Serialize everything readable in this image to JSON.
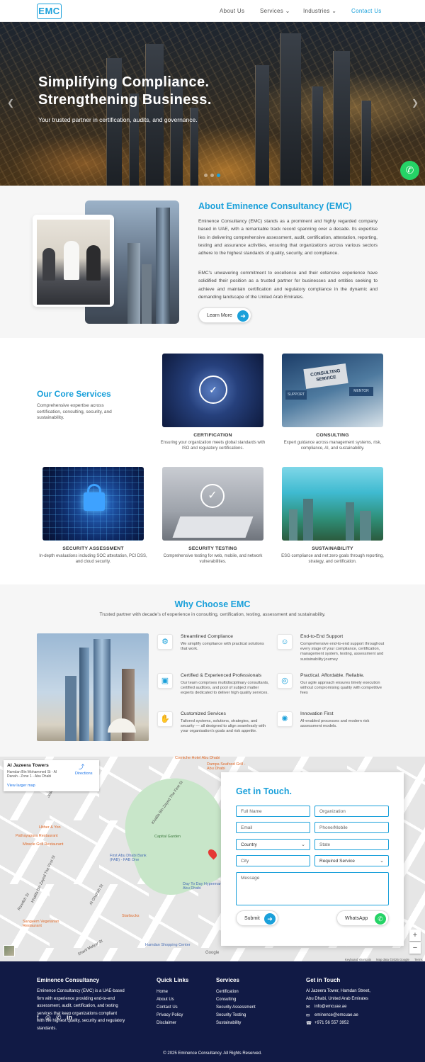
{
  "header": {
    "logo": "EMC",
    "nav": [
      {
        "label": "About Us"
      },
      {
        "label": "Services ⌄"
      },
      {
        "label": "Industries ⌄"
      },
      {
        "label": "Contact Us"
      }
    ]
  },
  "hero": {
    "title_line1": "Simplifying Compliance.",
    "title_line2": "Strengthening Business.",
    "subtitle": "Your trusted partner in certification, audits, and governance.",
    "prev_icon": "chevron-left-icon",
    "next_icon": "chevron-right-icon",
    "whatsapp_icon": "whatsapp-icon"
  },
  "about": {
    "title": "About Eminence Consultancy (EMC)",
    "para1": "Eminence Consultancy (EMC) stands as a prominent and highly regarded company based in UAE, with a remarkable track record spanning over a decade. Its expertise lies in delivering comprehensive assessment, audit, certification, attestation, reporting, testing and assurance activities, ensuring that organizations across various sectors adhere to the highest standards of quality, security, and compliance.",
    "para2": "EMC's unwavering commitment to excellence and their extensive experience have solidified their position as a trusted partner for businesses and entities seeking to achieve and maintain certification and regulatory compliance in the dynamic and demanding landscape of the United Arab Emirates.",
    "button": "Learn More"
  },
  "services": {
    "title": "Our Core Services",
    "subtitle": "Comprehensive expertise across certification, consulting, security, and sustainability.",
    "items": [
      {
        "title": "CERTIFICATION",
        "desc": "Ensuring your organization meets global standards with ISO and regulatory certifications."
      },
      {
        "title": "CONSULTING",
        "desc": "Expert guidance across management systems, risk, compliance, AI, and sustainability."
      },
      {
        "title": "SECURITY ASSESSMENT",
        "desc": "In-depth evaluations including SOC attestation, PCI DSS, and cloud security."
      },
      {
        "title": "SECURITY TESTING",
        "desc": "Comprehensive testing for web, mobile, and network vulnerabilities."
      },
      {
        "title": "SUSTAINABILITY",
        "desc": "ESG compliance and net zero goals through reporting, strategy, and certification."
      }
    ],
    "card_text": {
      "consulting_sign": "CONSULTING SERVICE",
      "support": "SUPPORT",
      "mentor": "MENTOR"
    }
  },
  "why": {
    "title": "Why Choose EMC",
    "subtitle": "Trusted partner with decade's of experience in consulting, certification, testing, assessment and sustainability.",
    "items": [
      {
        "title": "Streamlined Compliance",
        "desc": "We simplify compliance with practical solutions that work."
      },
      {
        "title": "End-to-End Support",
        "desc": "Comprehensive end-to-end support throughout every stage of your compliance, certification, management system, testing, assessment and sustainability journey"
      },
      {
        "title": "Certified & Experienced Professionals",
        "desc": "Our team comprises multidisciplinary consultants, certified auditors, and pool of subject matter experts dedicated to deliver high quality services."
      },
      {
        "title": "Practical. Affordable. Reliable.",
        "desc": "Our agile approach ensures timely execution without compromising quality with competitive fees"
      },
      {
        "title": "Customized Services",
        "desc": "Tailored systems, solutions, strategies, and security — all designed to align seamlessly with your organisation's goals and risk appetite."
      },
      {
        "title": "Innovation First",
        "desc": "AI-enabled processes and modern risk assessment models."
      }
    ]
  },
  "map": {
    "place": "Al Jazeera Towers",
    "address": "Hamdan Bin Mohammed St - Al Danah - Zone 1 - Abu Dhabi",
    "directions": "Directions",
    "larger": "View larger map",
    "labels": {
      "corniche": "Corniche Hotel Abu Dhabi",
      "dampa": "Dampa Seafood Grill - Abu Dhabi",
      "hither": "Hither & Yon",
      "pathayapura": "Pathayapura Restaurant",
      "miracle": "Miracle Grill Restaurant",
      "capital": "Capital Garden",
      "fab": "First Abu Dhabi Bank (FAB) - FAB One",
      "daytoday": "Day To Day Hypermarket Abu Dhabi",
      "starbucks": "Starbucks",
      "sangeem": "Sangeem Vegetarian Restaurant",
      "hamdan": "Hamdan Shopping Center",
      "google": "Google",
      "keyboard": "Keyboard shortcuts",
      "mapdata": "Map data ©2025 Google",
      "terms": "Terms"
    },
    "streets": [
      "Al Falah St",
      "Jeddah St",
      "Al Azyam St",
      "Khalifa Bin Zayed The First St",
      "Hamdan Bin Mohammed St",
      "Al Bataeen St",
      "Rawdah St",
      "Al Ghafrah St",
      "Najda St",
      "Sheikh Rashid Bin Saeed St",
      "Sharif Matyar St",
      "Al Hisn St",
      "Al Wadhna St",
      "Nahyan The First St"
    ]
  },
  "contact": {
    "title": "Get in Touch.",
    "fields": {
      "full_name": "Full Name",
      "organization": "Organization",
      "email": "Email",
      "phone": "Phone/Mobile",
      "country": "Country",
      "state": "State",
      "city": "City",
      "service": "Required Service",
      "message": "Message"
    },
    "submit": "Submit",
    "whatsapp": "WhatsApp"
  },
  "footer": {
    "company_title": "Eminence Consultancy",
    "company_desc": "Eminence Consultancy (EMC) is a UAE-based firm with experience providing end-to-end assessment, audit, certification, and testing services that keep organizations compliant with the highest quality, security and regulatory standards.",
    "quick_title": "Quick Links",
    "quick_links": [
      "Home",
      "About Us",
      "Contact Us",
      "Privacy Policy",
      "Disclaimer"
    ],
    "services_title": "Services",
    "services": [
      "Certification",
      "Consulting",
      "Security Assessment",
      "Security Testing",
      "Sustainability"
    ],
    "touch_title": "Get in Touch",
    "address": "Al Jazeera Tower, Hamdan Street, Abu Dhabi, United Arab Emirates",
    "email1": "info@emcuae.ae",
    "email2": "eminence@emcuae.ae",
    "phone": "+971 56 557 3952",
    "social": [
      "facebook-icon",
      "instagram-icon",
      "whatsapp-icon",
      "linkedin-icon"
    ],
    "copyright": "© 2025 Eminence Consultancy. All Rights Reserved."
  },
  "colors": {
    "accent": "#1aa0da",
    "footer_bg": "#111a45",
    "whatsapp": "#25d366"
  }
}
